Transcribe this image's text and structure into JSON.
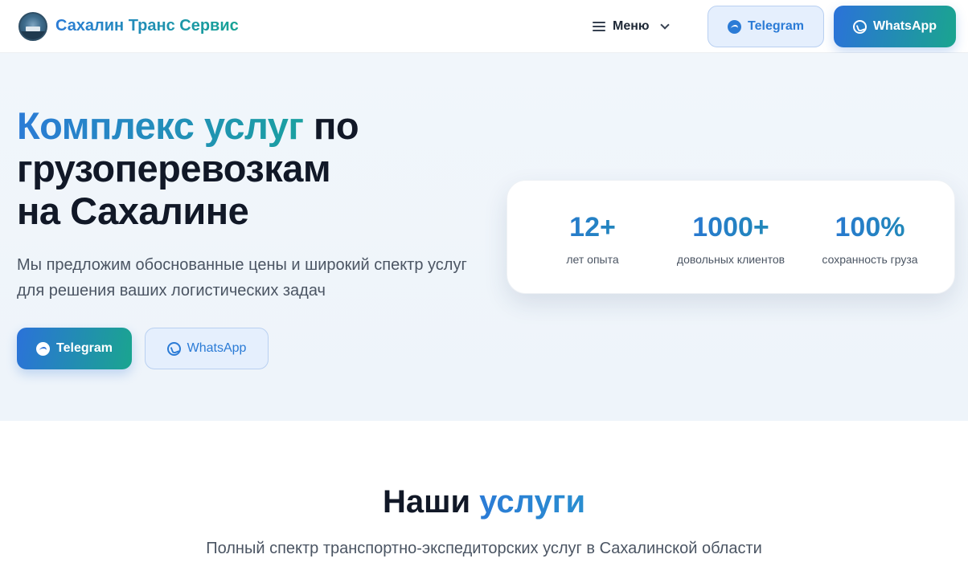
{
  "header": {
    "brand": "Сахалин Транс Сервис",
    "menu_label": "Меню",
    "telegram_label": "Telegram",
    "whatsapp_label": "WhatsApp"
  },
  "hero": {
    "title_accent": "Комплекс услуг",
    "title_rest_1": " по",
    "title_line_2": "грузоперевозкам",
    "title_line_3": "на Сахалине",
    "subtitle": "Мы предложим обоснованные цены и широкий спектр услуг для решения ваших логистических задач",
    "telegram_label": "Telegram",
    "whatsapp_label": "WhatsApp"
  },
  "stats": [
    {
      "value": "12+",
      "label": "лет опыта"
    },
    {
      "value": "1000+",
      "label": "довольных клиентов"
    },
    {
      "value": "100%",
      "label": "сохранность груза"
    }
  ],
  "services": {
    "title_plain": "Наши ",
    "title_accent": "услуги",
    "subtitle": "Полный спектр транспортно-экспедиторских услуг в Сахалинской области"
  },
  "colors": {
    "accent_blue": "#2b7bd6",
    "accent_teal": "#1aa58f",
    "hero_bg": "#f1f6fb"
  },
  "icons": [
    "logo",
    "menu-icon",
    "chevron-down-icon",
    "telegram-icon",
    "whatsapp-icon"
  ]
}
